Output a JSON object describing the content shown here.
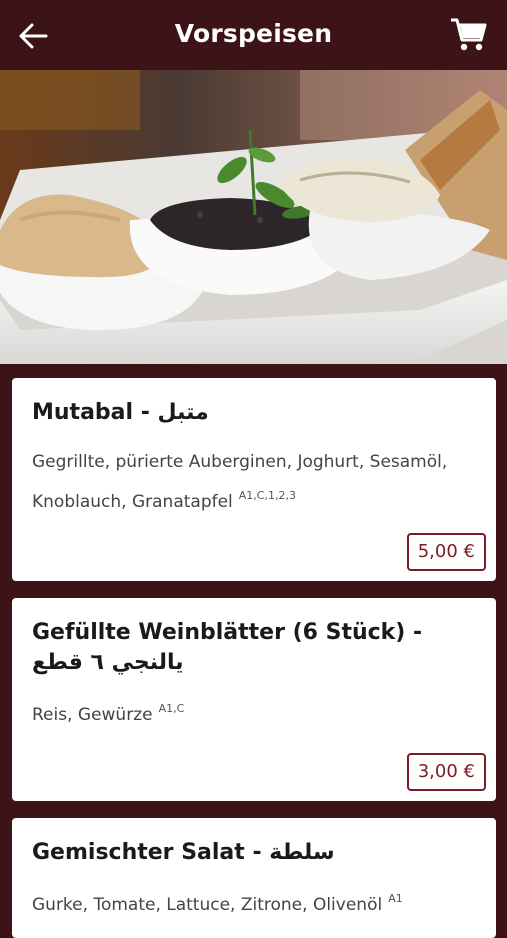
{
  "header": {
    "title": "Vorspeisen",
    "back_icon": "arrow-left-icon",
    "cart_icon": "shopping-cart-icon"
  },
  "colors": {
    "primary": "#3c1418",
    "price_accent": "#7a1c26",
    "card_bg": "#ffffff"
  },
  "hero": {
    "image": "mezze-dips-platter"
  },
  "items": [
    {
      "title": "Mutabal - متبل",
      "description": "Gegrillte, pürierte Auberginen, Joghurt, Sesamöl, Knoblauch, Granatapfel",
      "allergens": "A1,C,1,2,3",
      "price": "5,00 €"
    },
    {
      "title": "Gefüllte Weinblätter (6 Stück) - يالنجي ٦ قطع",
      "description": "Reis, Gewürze",
      "allergens": "A1,C",
      "price": "3,00 €"
    },
    {
      "title": "Gemischter Salat - سلطة",
      "description": "Gurke, Tomate, Lattuce, Zitrone, Olivenöl",
      "allergens": "A1",
      "price": ""
    }
  ]
}
